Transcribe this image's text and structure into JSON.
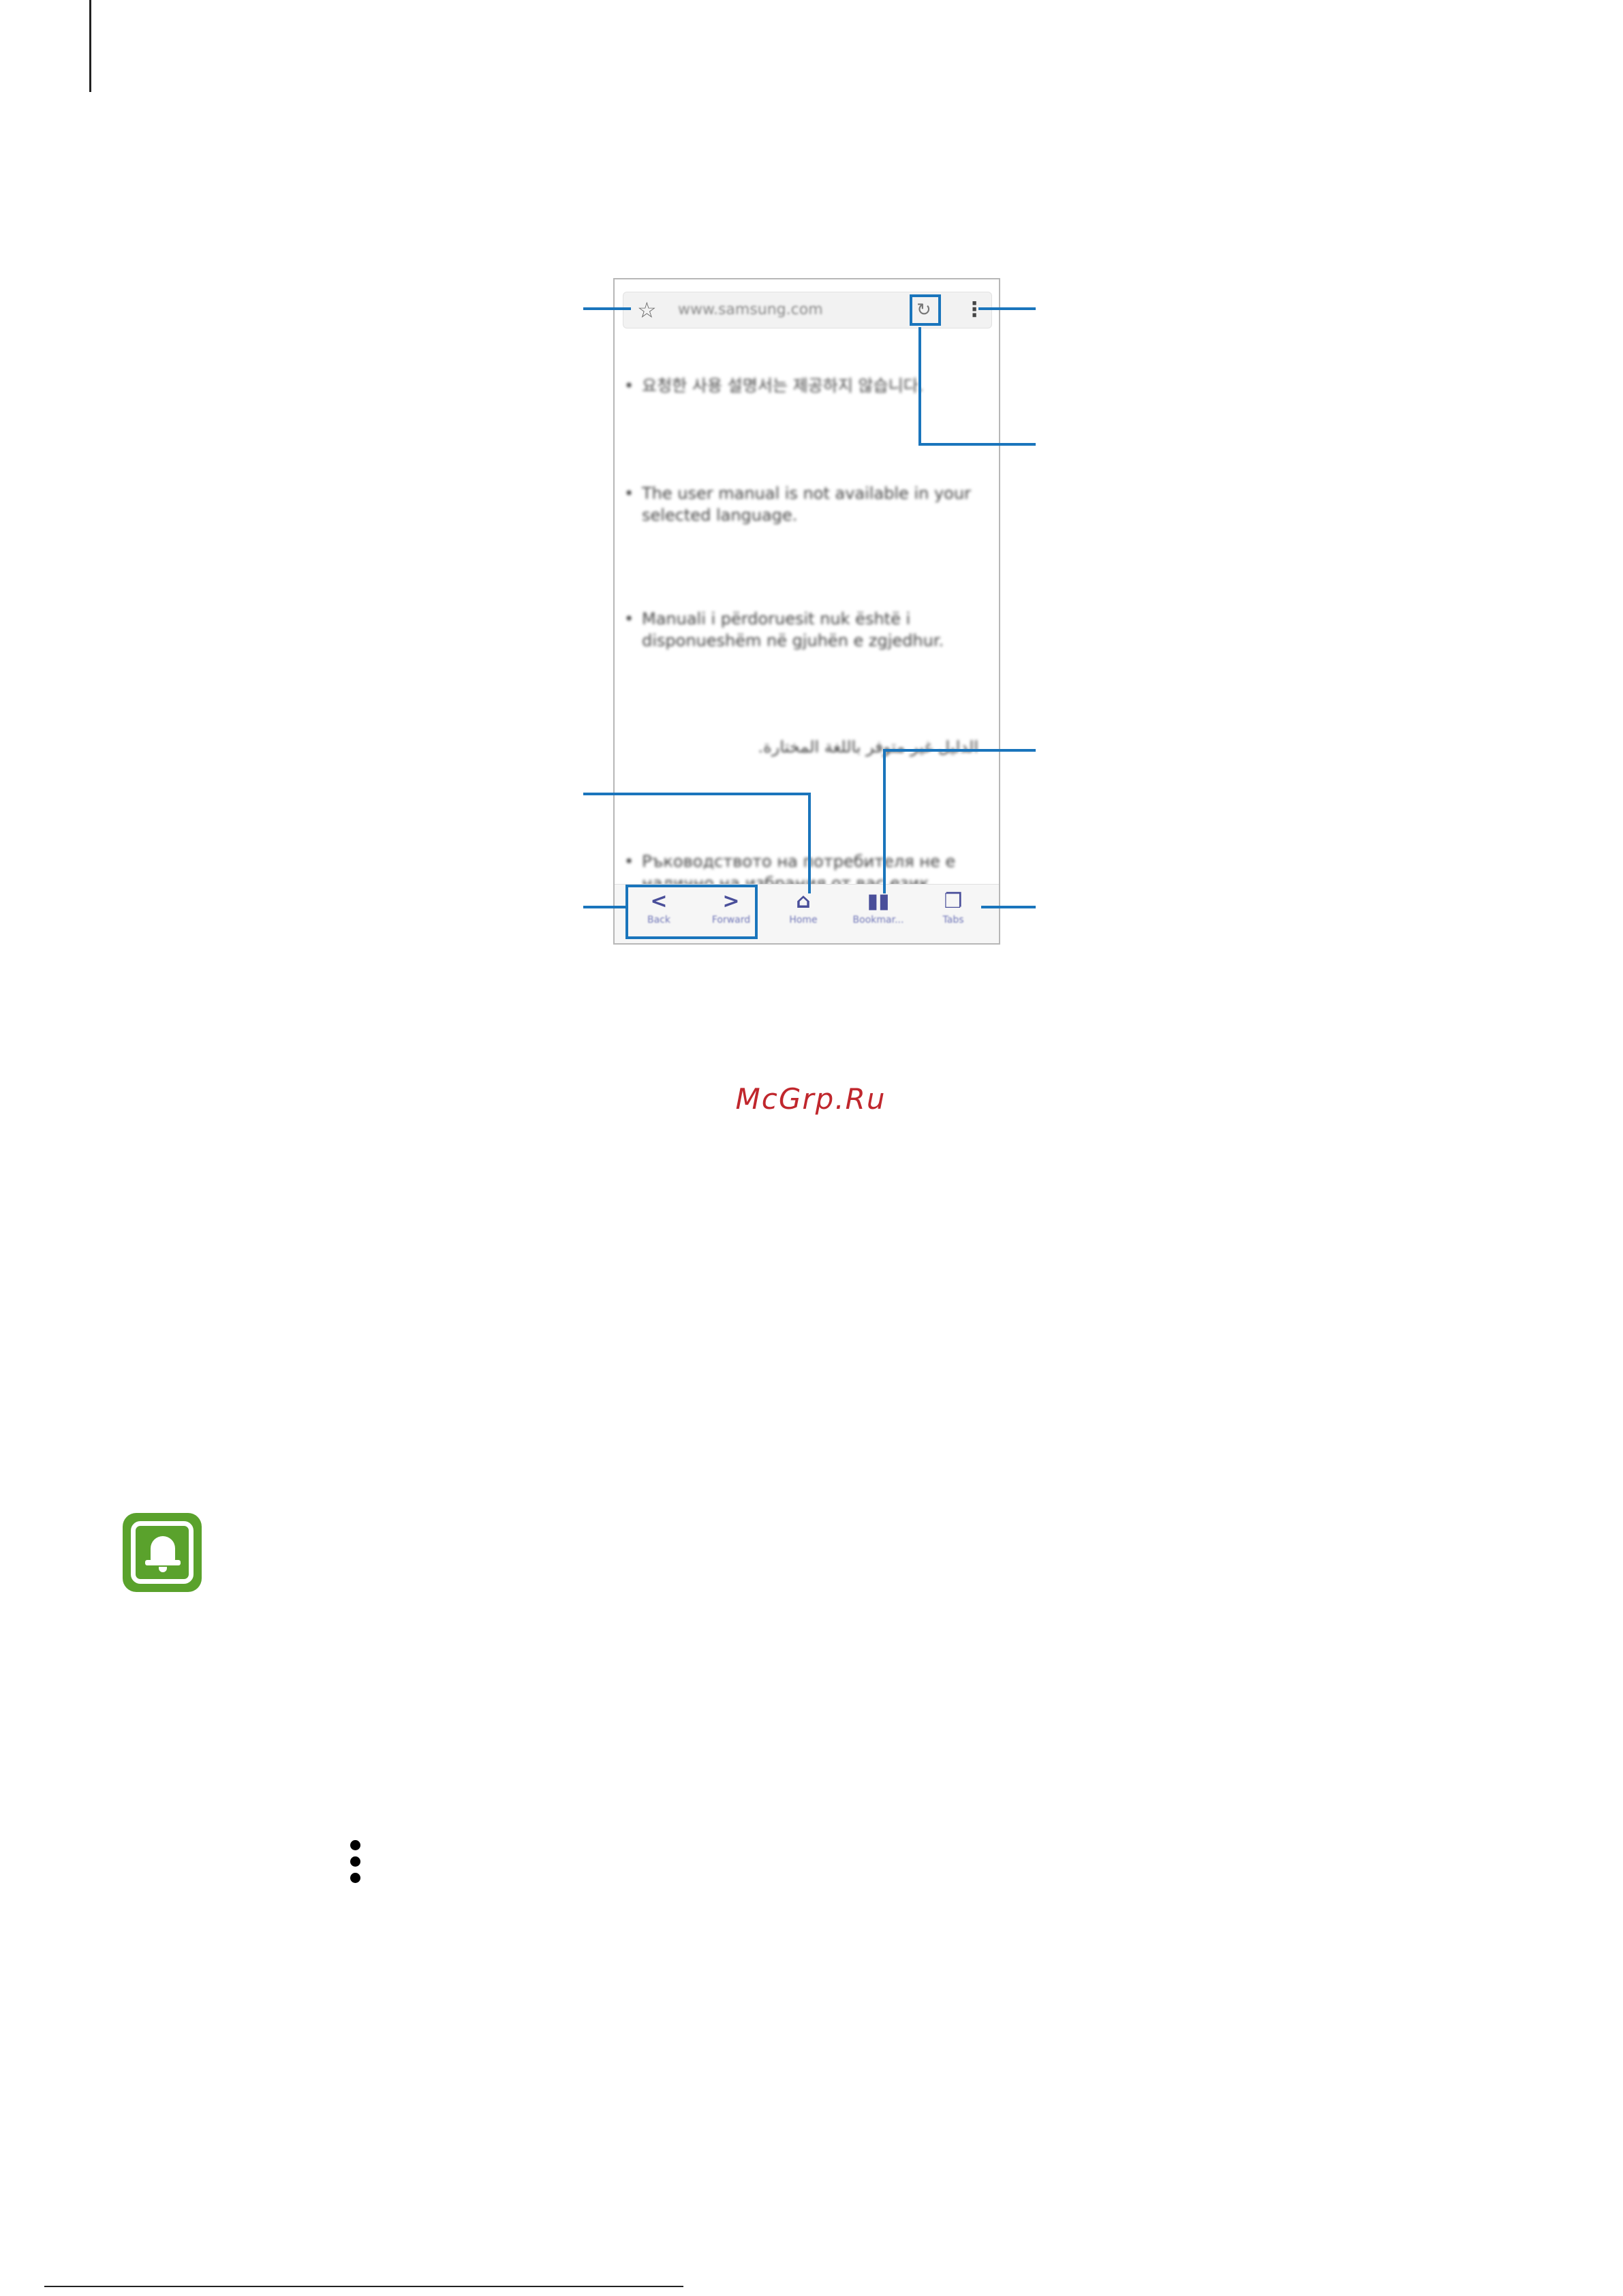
{
  "browser": {
    "url": "www.samsung.com",
    "paragraphs": [
      "요청한 사용 설명서는 제공하지 않습니다.",
      "The user manual is not available in your selected language.",
      "Manuali i përdoruesit nuk është i disponueshëm në gjuhën e zgjedhur.",
      "الدليل غير متوفر باللغة المختارة.",
      "Ръководството на потребителя не е налично на избрания от вас език."
    ],
    "bottom_nav": [
      {
        "label": "Back",
        "icon": "chevron-left-icon",
        "glyph": "<"
      },
      {
        "label": "Forward",
        "icon": "chevron-right-icon",
        "glyph": ">"
      },
      {
        "label": "Home",
        "icon": "home-icon",
        "glyph": "⌂"
      },
      {
        "label": "Bookmar...",
        "icon": "bookmark-book-icon",
        "glyph": "▮▮"
      },
      {
        "label": "Tabs",
        "icon": "tabs-icon",
        "glyph": "❐"
      }
    ],
    "icons": {
      "star": "star-icon",
      "refresh": "refresh-icon",
      "menu": "more-options-icon"
    },
    "accent_color": "#1a75bc",
    "nav_icon_color": "#4a4f9a"
  },
  "watermark": "McGrp.Ru",
  "notice": {
    "icon": "bell-notice-icon",
    "color": "#5aa22c"
  },
  "inline_icon": "more-options-vertical-icon"
}
